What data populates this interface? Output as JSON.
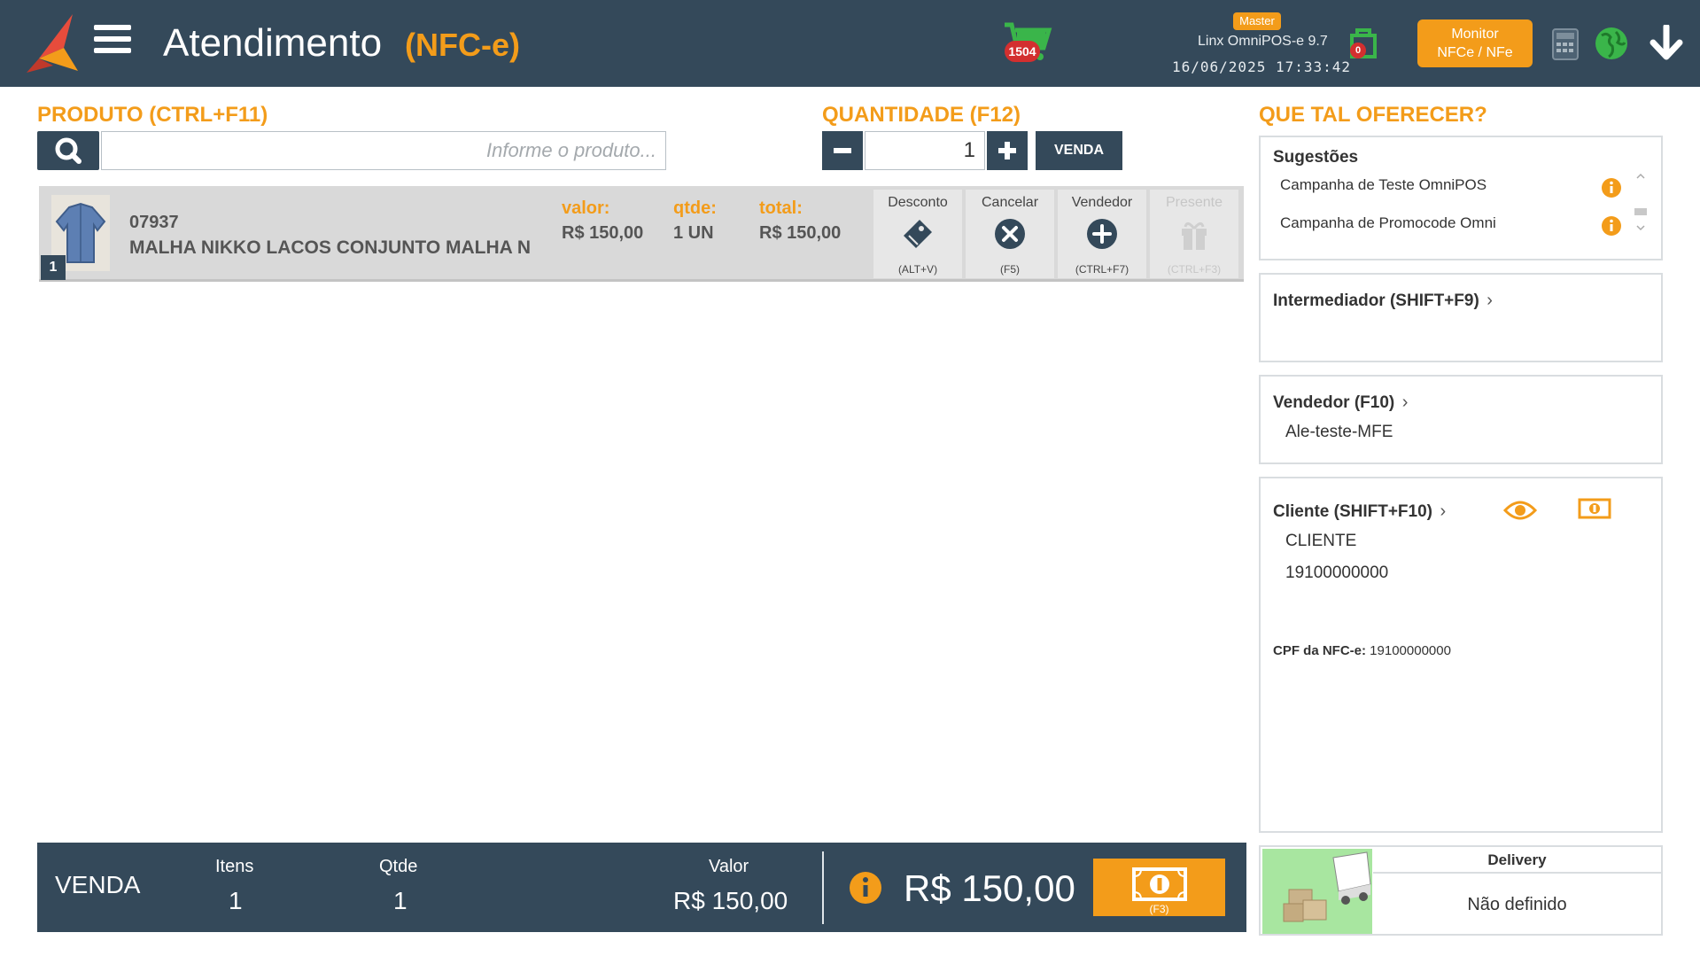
{
  "header": {
    "title": "Atendimento",
    "subtitle": "(NFC-e)",
    "cart_count": "1504",
    "role_badge": "Master",
    "app_version": "Linx OmniPOS-e  9.7",
    "datetime": "16/06/2025 17:33:42",
    "package_count": "0",
    "monitor_line1": "Monitor",
    "monitor_line2": "NFCe / NFe"
  },
  "product": {
    "label": "PRODUTO (CTRL+F11)",
    "placeholder": "Informe o produto..."
  },
  "quantity": {
    "label": "QUANTIDADE (F12)",
    "value": "1",
    "sell_button": "VENDA"
  },
  "items": [
    {
      "index": "1",
      "code": "07937",
      "description": "MALHA NIKKO LACOS CONJUNTO MALHA N",
      "valor_label": "valor:",
      "valor": "R$ 150,00",
      "qtde_label": "qtde:",
      "qtde": "1 UN",
      "total_label": "total:",
      "total": "R$ 150,00"
    }
  ],
  "item_actions": [
    {
      "label": "Desconto",
      "key": "(ALT+V)"
    },
    {
      "label": "Cancelar",
      "key": "(F5)"
    },
    {
      "label": "Vendedor",
      "key": "(CTRL+F7)"
    },
    {
      "label": "Presente",
      "key": "(CTRL+F3)"
    }
  ],
  "suggestions": {
    "heading": "QUE TAL OFERECER?",
    "title": "Sugestões",
    "items": [
      "Campanha de Teste OmniPOS",
      "Campanha de Promocode Omni"
    ]
  },
  "intermediador": {
    "title": "Intermediador (SHIFT+F9)"
  },
  "vendedor": {
    "title": "Vendedor (F10)",
    "value": "Ale-teste-MFE"
  },
  "cliente": {
    "title": "Cliente (SHIFT+F10)",
    "name": "CLIENTE",
    "doc": "19100000000",
    "cpf_label": "CPF da NFC-e:",
    "cpf_value": "19100000000"
  },
  "summary": {
    "label": "VENDA",
    "itens_label": "Itens",
    "itens": "1",
    "qtde_label": "Qtde",
    "qtde": "1",
    "valor_label": "Valor",
    "valor": "R$ 150,00",
    "total": "R$ 150,00",
    "pay_key": "(F3)"
  },
  "delivery": {
    "title": "Delivery",
    "value": "Não definido"
  },
  "colors": {
    "accent": "#f39c1a",
    "dark": "#34495a",
    "row": "#d9d9d9"
  }
}
